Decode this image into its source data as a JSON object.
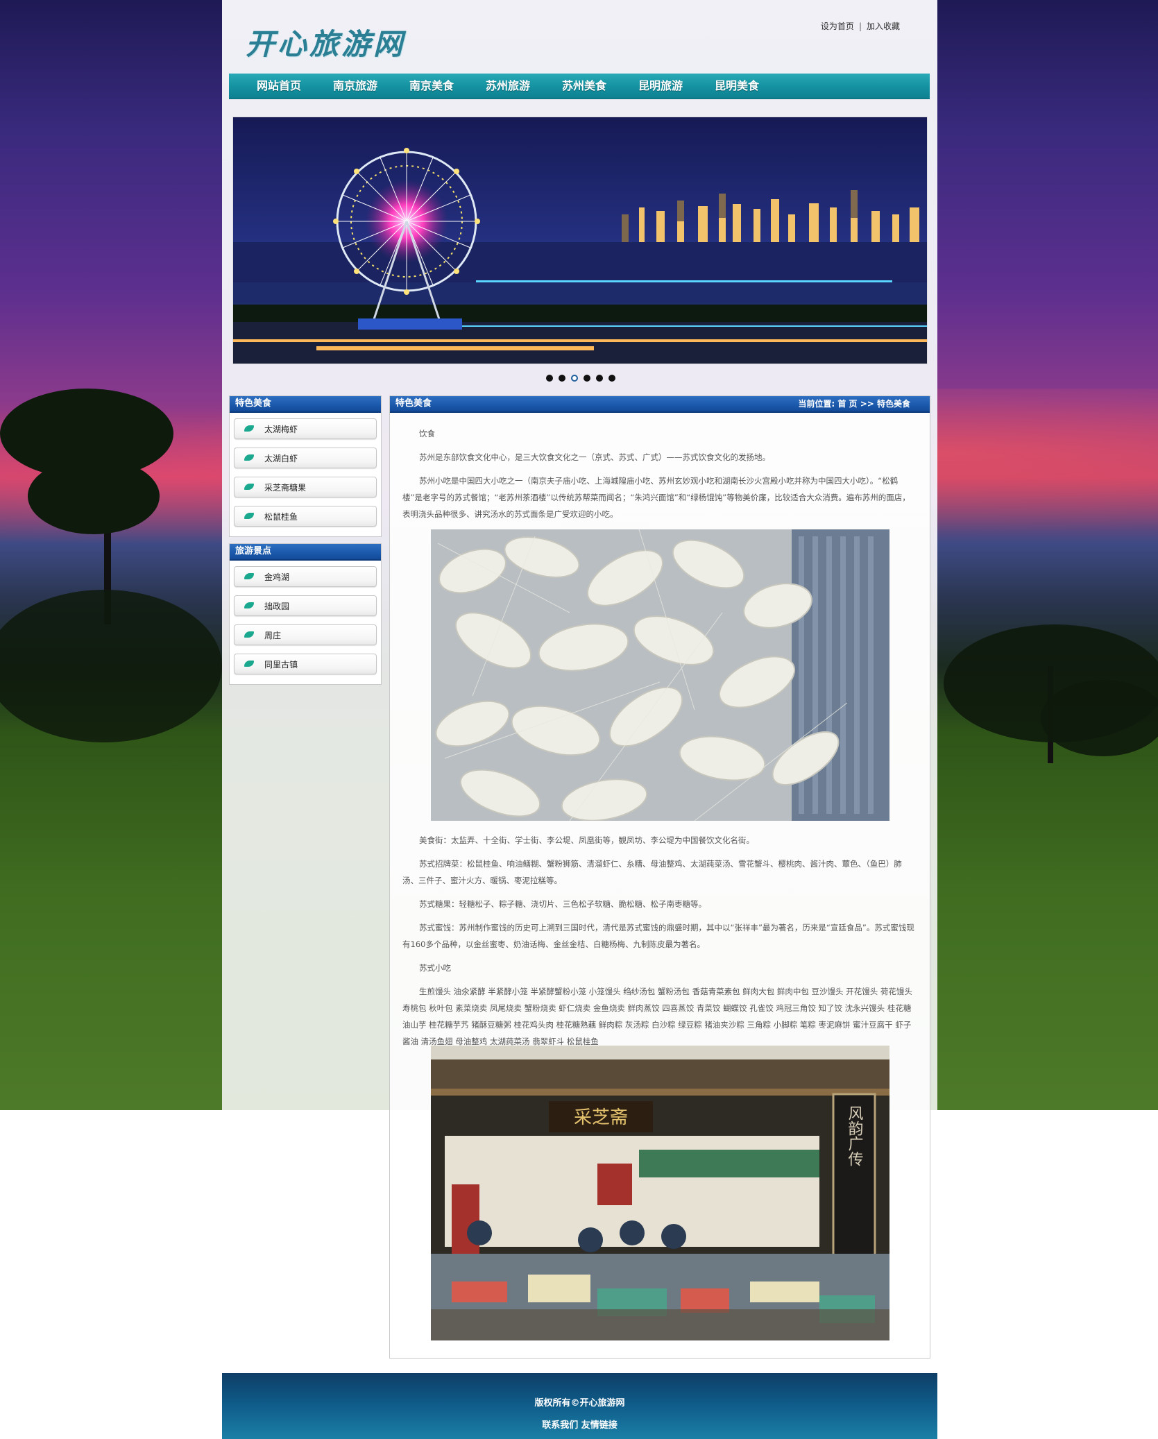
{
  "site": {
    "logo": "开心旅游网",
    "set_home": "设为首页",
    "separator": "|",
    "add_favorite": "加入收藏"
  },
  "nav": {
    "items": [
      "网站首页",
      "南京旅游",
      "南京美食",
      "苏州旅游",
      "苏州美食",
      "昆明旅游",
      "昆明美食"
    ]
  },
  "slider": {
    "dot_count": 6,
    "active_index": 2
  },
  "sidebar": {
    "food_title": "特色美食",
    "food_items": [
      "太湖梅虾",
      "太湖白虾",
      "采芝斋糖果",
      "松鼠桂鱼"
    ],
    "spots_title": "旅游景点",
    "spots_items": [
      "金鸡湖",
      "拙政园",
      "周庄",
      "同里古镇"
    ]
  },
  "main": {
    "title": "特色美食",
    "crumb_label": "当前位置:",
    "crumb_home": "首 页",
    "crumb_sep": ">>",
    "crumb_current": "特色美食",
    "p1": "饮食",
    "p2": "苏州是东部饮食文化中心，是三大饮食文化之一（京式、苏式、广式）——苏式饮食文化的发扬地。",
    "p3": "苏州小吃是中国四大小吃之一（南京夫子庙小吃、上海城隍庙小吃、苏州玄妙观小吃和湖南长沙火宫殿小吃并称为中国四大小吃）。“松鹤楼”是老字号的苏式餐馆；“老苏州茶酒楼”以传统苏帮菜而闻名；“朱鸿兴面馆”和“绿杨馄饨”等物美价廉，比较适合大众消费。遍布苏州的面店，表明浇头品种很多、讲究汤水的苏式面条是广受欢迎的小吃。",
    "p4": "美食街：太监弄、十全街、学士街、李公堤、凤凰街等，観凤坊、李公堤为中国餐饮文化名街。",
    "p5": "苏式招牌菜：松鼠桂鱼、响油鳝糊、蟹粉狮筋、清溜虾仁、糸糟、母油整鸡、太湖莼菜汤、雪花蟹斗、樱桃肉、酱汁肉、蕈色、（鱼巴）肺汤、三件子、蜜汁火方、暖锅、枣泥拉糕等。",
    "p6": "苏式糖果：轻糖松子、粽子糖、浇切片、三色松子软糖、脆松糖、松子南枣糖等。",
    "p7": "苏式蜜饯：苏州制作蜜饯的历史可上溯到三国时代，清代是苏式蜜饯的鼎盛时期，其中以“张祥丰”最为著名，历来是“宣廷食品”。苏式蜜饯现有160多个品种，以金丝蜜枣、奶油话梅、金丝金桔、白糖杨梅、九制陈皮最为著名。",
    "p8": "苏式小吃",
    "p9": "生煎馒头 油氽紧酵 半紧酵小笼 半紧酵蟹粉小笼 小笼馒头 绉纱汤包 蟹粉汤包 香菇青菜素包 鲜肉大包 鲜肉中包 豆沙馒头 开花馒头 荷花馒头 寿桃包 秋叶包 素菜烧卖 凤尾烧卖 蟹粉烧卖 虾仁烧卖 金鱼烧卖 鲜肉蒸饺 四喜蒸饺 青菜饺 蝴蝶饺 孔雀饺 鸡冠三角饺 知了饺 沈永兴馒头 桂花糖油山芋 桂花糖芋艿 猪酥豆糖粥 桂花鸡头肉 桂花糖熟藕 鲜肉粽 灰汤粽 白沙粽 绿豆粽 猪油夹沙粽 三角粽 小脚粽 笔粽 枣泥麻饼 蜜汁豆腐干 虾子酱油 清汤鱼翅 母油整鸡 太湖莼菜汤 翡翠虾斗 松鼠桂鱼",
    "shrimp_alt": "shrimp-photo",
    "shop_alt": "shop-photo",
    "shop_sign": "采芝斋",
    "shop_couplet": "风韵广传"
  },
  "footer": {
    "copyright": "版权所有©开心旅游网",
    "contact": "联系我们",
    "links": "友情链接"
  },
  "colors": {
    "nav": "#1593a2",
    "box_title": "#1a58ab",
    "footer": "#0f5a88",
    "leaf": "#1aa88f",
    "logo": "#2a7f94"
  }
}
